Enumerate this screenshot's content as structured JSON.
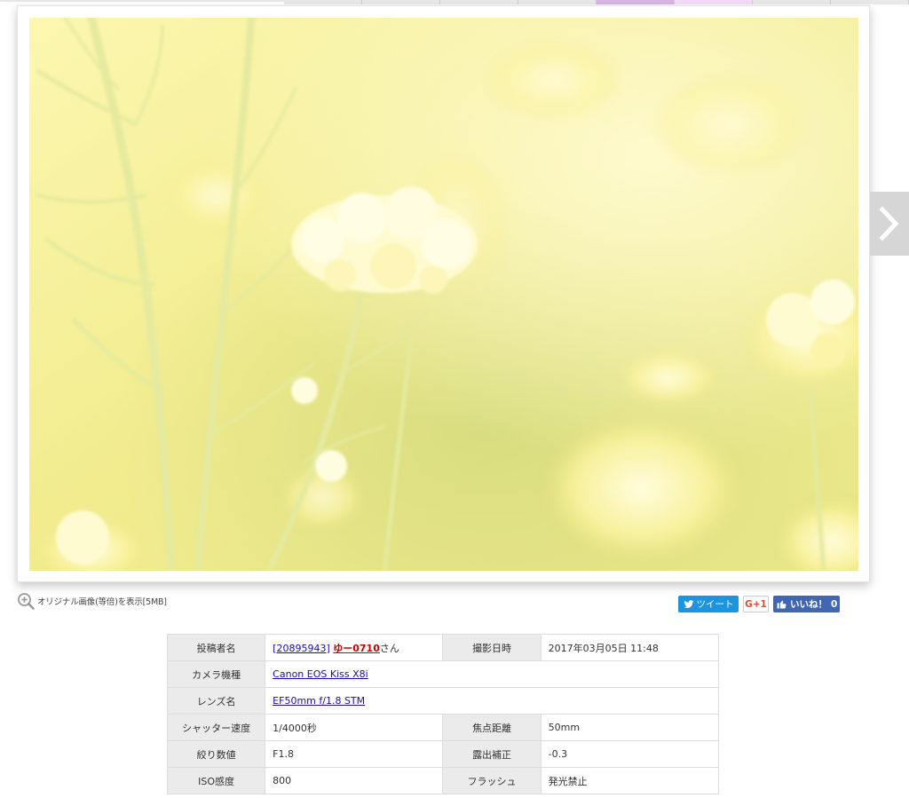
{
  "photo": {
    "alt": "rapeseed flowers"
  },
  "original_link": {
    "label": "オリジナル画像(等倍)を表示[5MB]"
  },
  "share": {
    "tweet_label": "ツイート",
    "gplus_label": "G+1",
    "like_label": "いいね！",
    "like_count": "0"
  },
  "info": {
    "poster_label": "投稿者名",
    "poster_id": "[20895943]",
    "poster_name": "ゆー0710",
    "poster_suffix": "さん",
    "date_label": "撮影日時",
    "date_value": "2017年03月05日 11:48",
    "camera_label": "カメラ機種",
    "camera_value": "Canon EOS Kiss X8i",
    "lens_label": "レンズ名",
    "lens_value": "EF50mm f/1.8 STM",
    "shutter_label": "シャッター速度",
    "shutter_value": "1/4000秒",
    "focal_label": "焦点距離",
    "focal_value": "50mm",
    "aperture_label": "絞り数値",
    "aperture_value": "F1.8",
    "exposure_label": "露出補正",
    "exposure_value": "-0.3",
    "iso_label": "ISO感度",
    "iso_value": "800",
    "flash_label": "フラッシュ",
    "flash_value": "発光禁止"
  },
  "colors": {
    "tweet": "#1b95e0",
    "like": "#4267b2",
    "gplus": "#dd4b39",
    "username": "#cc0000"
  }
}
